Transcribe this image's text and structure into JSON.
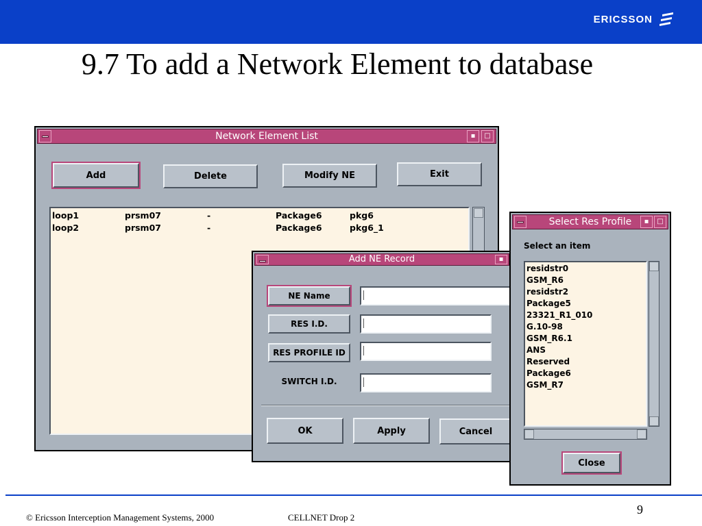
{
  "header": {
    "brand": "ERICSSON"
  },
  "slide": {
    "title": "9.7 To add a Network Element to database"
  },
  "ne_list_window": {
    "title": "Network Element List",
    "buttons": {
      "add": "Add",
      "delete": "Delete",
      "modify": "Modify NE",
      "exit": "Exit"
    },
    "rows": [
      {
        "name": "loop1",
        "host": "prsm07",
        "dash": "-",
        "package": "Package6",
        "pkg": "pkg6"
      },
      {
        "name": "loop2",
        "host": "prsm07",
        "dash": "-",
        "package": "Package6",
        "pkg": "pkg6_1"
      }
    ]
  },
  "add_record_window": {
    "title": "Add NE Record",
    "fields": {
      "ne_name": "NE Name",
      "res_id": "RES I.D.",
      "res_profile": "RES PROFILE ID",
      "switch_id": "SWITCH I.D."
    },
    "buttons": {
      "ok": "OK",
      "apply": "Apply",
      "cancel": "Cancel"
    }
  },
  "res_profile_window": {
    "title": "Select Res Profile",
    "prompt": "Select an item",
    "items": [
      "residstr0",
      "GSM_R6",
      "residstr2",
      "Package5",
      "23321_R1_010",
      "G.10-98",
      "GSM_R6.1",
      "ANS",
      "Reserved",
      "Package6",
      "GSM_R7"
    ],
    "close": "Close"
  },
  "footer": {
    "copyright": "© Ericsson Interception Management Systems, 2000",
    "product": "CELLNET Drop 2",
    "page": "9"
  },
  "colors": {
    "brand_blue": "#0a40c8",
    "titlebar": "#b8467a",
    "window_bg": "#aab3bd",
    "list_bg": "#fdf4e4"
  }
}
